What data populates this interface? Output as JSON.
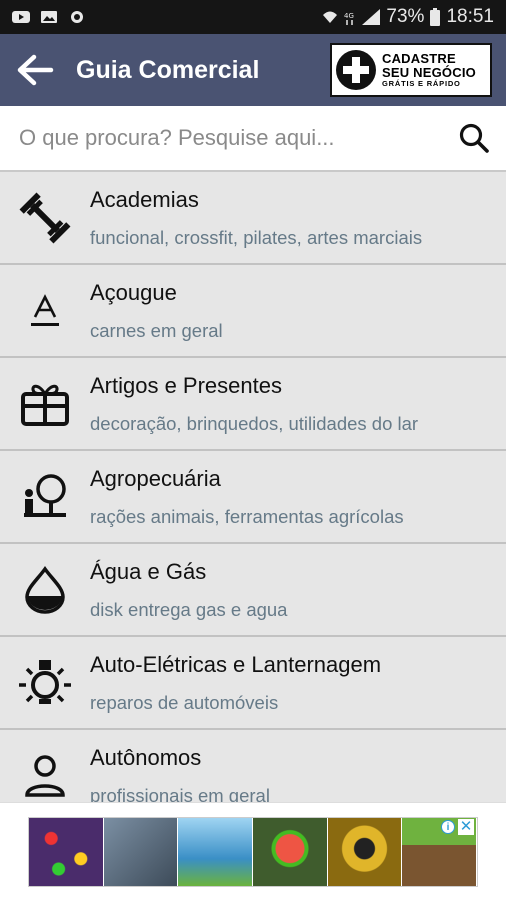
{
  "status_bar": {
    "battery": "73%",
    "time": "18:51",
    "icons": [
      "youtube-icon",
      "image-icon",
      "whatsapp-icon",
      "wifi-icon",
      "4g-icon",
      "signal-icon",
      "battery-icon"
    ]
  },
  "header": {
    "title": "Guia Comercial",
    "back_icon": "arrow-left-icon",
    "cadastre": {
      "line1": "CADASTRE",
      "line2": "SEU NEGÓCIO",
      "line3": "GRÁTIS E RÁPIDO"
    }
  },
  "search": {
    "placeholder": "O que procura? Pesquise aqui...",
    "value": "",
    "icon": "search-icon"
  },
  "categories": [
    {
      "title": "Academias",
      "subtitle": "funcional, crossfit, pilates, artes marciais",
      "icon": "dumbbell-icon"
    },
    {
      "title": "Açougue",
      "subtitle": "carnes em geral",
      "icon": "letter-a-icon"
    },
    {
      "title": "Artigos e Presentes",
      "subtitle": "decoração, brinquedos, utilidades do lar",
      "icon": "gift-icon"
    },
    {
      "title": "Agropecuária",
      "subtitle": "rações animais, ferramentas agrícolas",
      "icon": "tree-icon"
    },
    {
      "title": "Água e Gás",
      "subtitle": "disk entrega gas e agua",
      "icon": "drop-icon"
    },
    {
      "title": "Auto-Elétricas e Lanternagem",
      "subtitle": "reparos de automóveis",
      "icon": "lightbulb-icon"
    },
    {
      "title": "Autônomos",
      "subtitle": "profissionais em geral",
      "icon": "person-icon"
    }
  ],
  "ad": {
    "tiles": [
      "",
      "",
      "",
      "",
      "",
      ""
    ],
    "colors": [
      "#4a2c6b",
      "#5b6f83",
      "#5aa7d9",
      "#3f5c2d",
      "#c4a21b",
      "#4b7a3a"
    ]
  }
}
